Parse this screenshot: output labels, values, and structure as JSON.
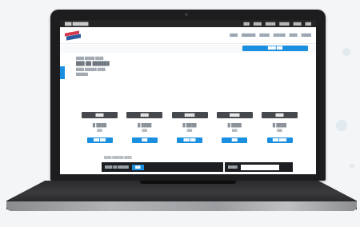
{
  "topbar": {
    "brand": "███ ███████",
    "links": [
      "███",
      "████",
      "█████",
      "█████",
      "████",
      "███"
    ]
  },
  "nav": {
    "items": [
      "████",
      "███████",
      "█████",
      "██████",
      "████",
      "█████"
    ]
  },
  "cta": {
    "label": "████ ███"
  },
  "content": {
    "breadcrumb": "████ █████ ████",
    "heading": "███ ██ ██████",
    "subtitle": "████ ██████ ████",
    "section": "██████"
  },
  "plans": [
    {
      "name": "████",
      "price": "█ ████",
      "note": "███",
      "button": "███ ███"
    },
    {
      "name": "████",
      "price": "█ ████",
      "note": "███",
      "button": "███"
    },
    {
      "name": "█████",
      "price": "█ ████",
      "note": "███",
      "button": "███ ███"
    },
    {
      "name": "█████",
      "price": "█ ████",
      "note": "███",
      "button": "███"
    },
    {
      "name": "████",
      "price": "█ ████",
      "note": "███",
      "button": "███ ████"
    }
  ],
  "footer": {
    "note": "████ ██████ ████",
    "bar_text": "████ ██ ██████",
    "bar_button": "███",
    "bar2_text": "█████",
    "search_placeholder": ""
  },
  "colors": {
    "accent": "#1a8fe0",
    "dark": "#1c1e21",
    "plan_header": "#45484c"
  }
}
